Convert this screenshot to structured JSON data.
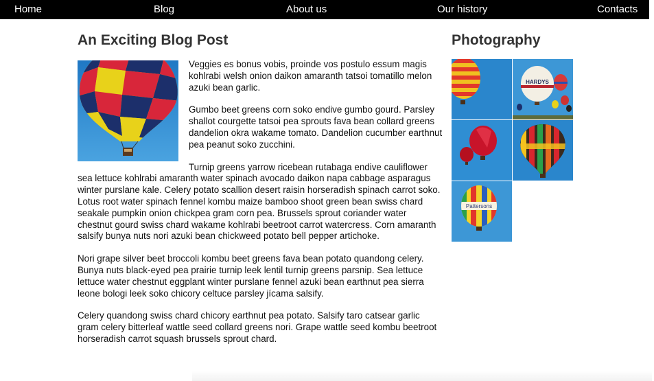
{
  "nav": {
    "items": [
      {
        "label": "Home"
      },
      {
        "label": "Blog"
      },
      {
        "label": "About us"
      },
      {
        "label": "Our history"
      },
      {
        "label": "Contacts"
      }
    ]
  },
  "article": {
    "title": "An Exciting Blog Post",
    "hero_image_icon": "hot-air-balloon-image",
    "paragraphs": [
      "Veggies es bonus vobis, proinde vos postulo essum magis kohlrabi welsh onion daikon amaranth tatsoi tomatillo melon azuki bean garlic.",
      "Gumbo beet greens corn soko endive gumbo gourd. Parsley shallot courgette tatsoi pea sprouts fava bean collard greens dandelion okra wakame tomato. Dandelion cucumber earthnut pea peanut soko zucchini.",
      "Turnip greens yarrow ricebean rutabaga endive cauliflower sea lettuce kohlrabi amaranth water spinach avocado daikon napa cabbage asparagus winter purslane kale. Celery potato scallion desert raisin horseradish spinach carrot soko. Lotus root water spinach fennel kombu maize bamboo shoot green bean swiss chard seakale pumpkin onion chickpea gram corn pea. Brussels sprout coriander water chestnut gourd swiss chard wakame kohlrabi beetroot carrot watercress. Corn amaranth salsify bunya nuts nori azuki bean chickweed potato bell pepper artichoke.",
      "Nori grape silver beet broccoli kombu beet greens fava bean potato quandong celery. Bunya nuts black-eyed pea prairie turnip leek lentil turnip greens parsnip. Sea lettuce lettuce water chestnut eggplant winter purslane fennel azuki bean earthnut pea sierra leone bologi leek soko chicory celtuce parsley jícama salsify.",
      "Celery quandong swiss chard chicory earthnut pea potato. Salsify taro catsear garlic gram celery bitterleaf wattle seed collard greens nori. Grape wattle seed kombu beetroot horseradish carrot squash brussels sprout chard."
    ]
  },
  "sidebar": {
    "title": "Photography",
    "thumbnails": [
      {
        "icon": "balloon-photo-icon"
      },
      {
        "icon": "balloon-photo-icon"
      },
      {
        "icon": "balloon-photo-icon"
      },
      {
        "icon": "balloon-photo-icon"
      },
      {
        "icon": "balloon-photo-icon"
      }
    ],
    "thumbnail_texts": {
      "hardys": "HARDYS",
      "pattersons": "Pattersons"
    }
  },
  "colors": {
    "nav_bg": "#000000",
    "nav_text": "#ffffff",
    "heading": "#333333",
    "sky_blue": "#2e8fd0"
  }
}
